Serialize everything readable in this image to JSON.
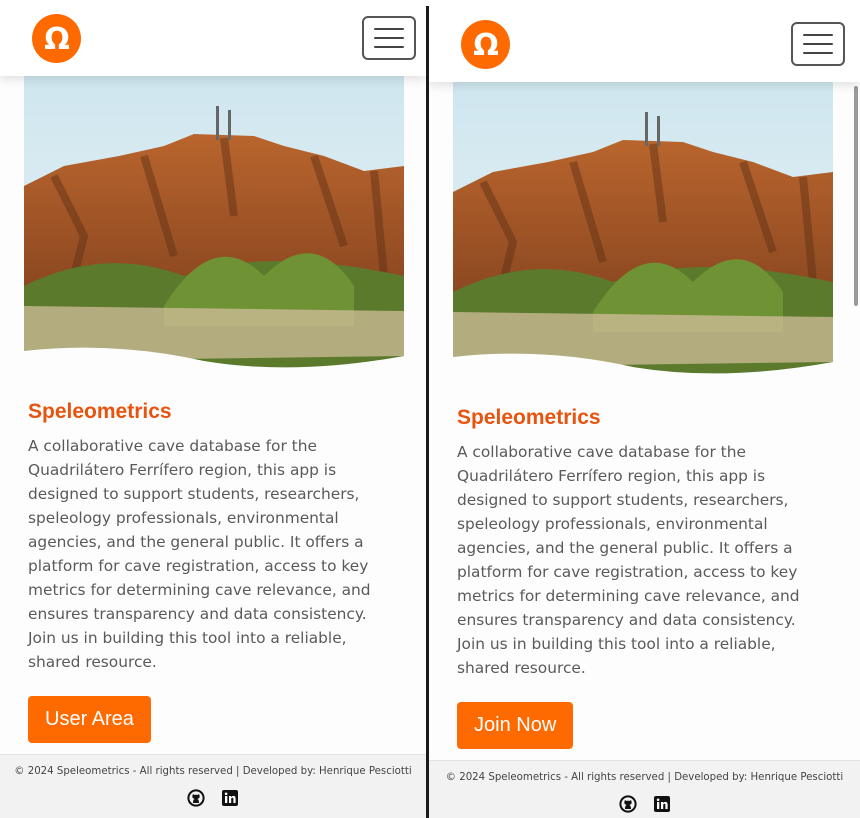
{
  "left_panel": {
    "brand": "Speleometrics",
    "title": "Speleometrics",
    "description": "A collaborative cave database for the Quadrilátero Ferrífero region, this app is designed to support students, researchers, speleology professionals, environmental agencies, and the general public. It offers a platform for cave registration, access to key metrics for determining cave relevance, and ensures transparency and data consistency. Join us in building this tool into a reliable, shared resource.",
    "cta_label": "User Area",
    "footer_text": "© 2024 Speleometrics - All rights reserved | Developed by: Henrique Pesciotti",
    "icons": [
      "omega-logo-icon",
      "hamburger-menu-icon",
      "github-icon",
      "linkedin-icon"
    ]
  },
  "right_panel": {
    "brand": "Speleometrics",
    "title": "Speleometrics",
    "description": "A collaborative cave database for the Quadrilátero Ferrífero region, this app is designed to support students, researchers, speleology professionals, environmental agencies, and the general public. It offers a platform for cave registration, access to key metrics for determining cave relevance, and ensures transparency and data consistency. Join us in building this tool into a reliable, shared resource.",
    "cta_label": "Join Now",
    "footer_text": "© 2024 Speleometrics - All rights reserved | Developed by: Henrique Pesciotti",
    "icons": [
      "omega-logo-icon",
      "hamburger-menu-icon",
      "github-icon",
      "linkedin-icon"
    ]
  },
  "colors": {
    "accent": "#ff6a00",
    "title": "#e8530e",
    "text": "#5a5a5a"
  }
}
